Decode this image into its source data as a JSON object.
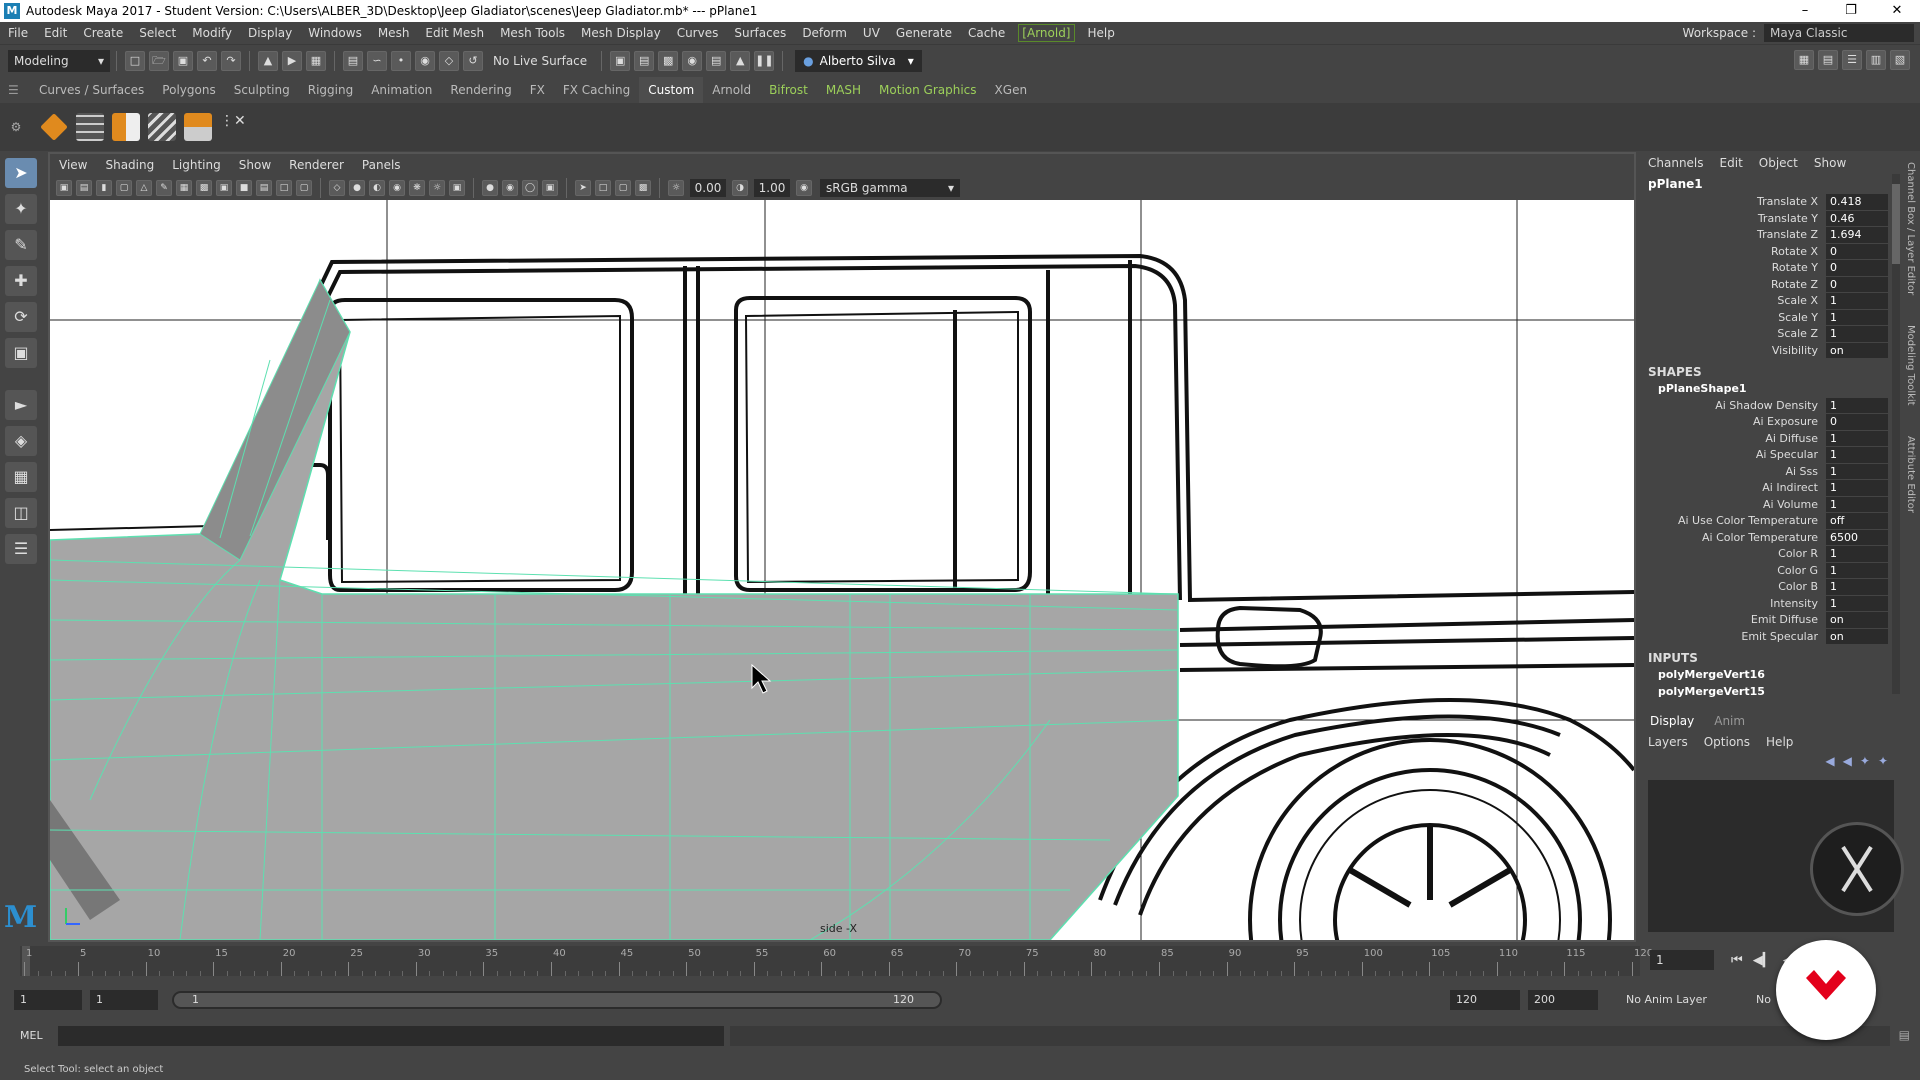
{
  "titlebar": {
    "title": "Autodesk Maya 2017 - Student Version: C:\\Users\\ALBER_3D\\Desktop\\Jeep Gladiator\\scenes\\Jeep Gladiator.mb*   ---   pPlane1",
    "logo": "M"
  },
  "menu": [
    "File",
    "Edit",
    "Create",
    "Select",
    "Modify",
    "Display",
    "Windows",
    "Mesh",
    "Edit Mesh",
    "Mesh Tools",
    "Mesh Display",
    "Curves",
    "Surfaces",
    "Deform",
    "UV",
    "Generate",
    "Cache"
  ],
  "menu_arnold": "[Arnold]",
  "menu_help": "Help",
  "workspace": {
    "label": "Workspace :",
    "value": "Maya Classic"
  },
  "status": {
    "mode": "Modeling",
    "live": "No Live Surface",
    "user": "Alberto Silva"
  },
  "shelf_tabs": [
    "Curves / Surfaces",
    "Polygons",
    "Sculpting",
    "Rigging",
    "Animation",
    "Rendering",
    "FX",
    "FX Caching",
    "Custom",
    "Arnold"
  ],
  "shelf_tabs_bracket": [
    "Bifrost",
    "MASH",
    "Motion Graphics"
  ],
  "shelf_tab_xgen": "XGen",
  "viewport": {
    "menu": [
      "View",
      "Shading",
      "Lighting",
      "Show",
      "Renderer",
      "Panels"
    ],
    "exposure": "0.00",
    "gamma": "1.00",
    "colorspace": "sRGB gamma",
    "camera": "side -X"
  },
  "channelbox": {
    "menu": [
      "Channels",
      "Edit",
      "Object",
      "Show"
    ],
    "object": "pPlane1",
    "attrs": [
      [
        "Translate X",
        "0.418"
      ],
      [
        "Translate Y",
        "0.46"
      ],
      [
        "Translate Z",
        "1.694"
      ],
      [
        "Rotate X",
        "0"
      ],
      [
        "Rotate Y",
        "0"
      ],
      [
        "Rotate Z",
        "0"
      ],
      [
        "Scale X",
        "1"
      ],
      [
        "Scale Y",
        "1"
      ],
      [
        "Scale Z",
        "1"
      ],
      [
        "Visibility",
        "on"
      ]
    ],
    "shapes_label": "SHAPES",
    "shape": "pPlaneShape1",
    "shape_attrs": [
      [
        "Ai Shadow Density",
        "1"
      ],
      [
        "Ai Exposure",
        "0"
      ],
      [
        "Ai Diffuse",
        "1"
      ],
      [
        "Ai Specular",
        "1"
      ],
      [
        "Ai Sss",
        "1"
      ],
      [
        "Ai Indirect",
        "1"
      ],
      [
        "Ai Volume",
        "1"
      ],
      [
        "Ai Use Color Temperature",
        "off"
      ],
      [
        "Ai Color Temperature",
        "6500"
      ],
      [
        "Color R",
        "1"
      ],
      [
        "Color G",
        "1"
      ],
      [
        "Color B",
        "1"
      ],
      [
        "Intensity",
        "1"
      ],
      [
        "Emit Diffuse",
        "on"
      ],
      [
        "Emit Specular",
        "on"
      ]
    ],
    "inputs_label": "INPUTS",
    "inputs": [
      "polyMergeVert16",
      "polyMergeVert15"
    ]
  },
  "sidetabs": [
    "Channel Box / Layer Editor",
    "Modeling Toolkit",
    "Attribute Editor"
  ],
  "layer_editor": {
    "tabs": [
      "Display",
      "Anim"
    ],
    "menu": [
      "Layers",
      "Options",
      "Help"
    ]
  },
  "timeline": {
    "ticks": [
      "1",
      "5",
      "10",
      "15",
      "20",
      "25",
      "30",
      "35",
      "40",
      "45",
      "50",
      "55",
      "60",
      "65",
      "70",
      "75",
      "80",
      "85",
      "90",
      "95",
      "100",
      "105",
      "110",
      "115",
      "120"
    ],
    "current": "1"
  },
  "range": {
    "start": "1",
    "start2": "1",
    "slider_start": "1",
    "slider_end": "120",
    "end": "120",
    "end2": "200",
    "anim_layer": "No Anim Layer",
    "char": "No"
  },
  "cmd": {
    "lang": "MEL"
  },
  "help": "Select Tool: select an object",
  "colors": {
    "accent": "#9ccf5a",
    "mesh": "#a6a6a6",
    "wire": "#5de0b0",
    "badge": "#e3001b"
  }
}
